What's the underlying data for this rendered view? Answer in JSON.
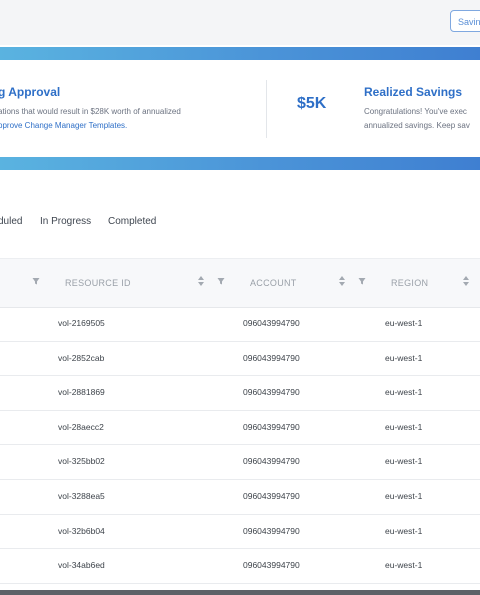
{
  "topbar": {
    "savings_button": "Savings"
  },
  "banner": {
    "left_title": "g Approval",
    "left_line1": "ations that would result in $28K worth of annualized",
    "left_line2": "pprove Change Manager Templates.",
    "big_value": "$5K",
    "right_title": "Realized Savings",
    "right_line1": "Congratulations! You've exec",
    "right_line2": "annualized savings. Keep sav"
  },
  "tabs": [
    "duled",
    "In Progress",
    "Completed"
  ],
  "table": {
    "headers": {
      "resource_id": "RESOURCE ID",
      "account": "ACCOUNT",
      "region": "REGION"
    },
    "rows": [
      {
        "resource_id": "vol-2169505",
        "account": "096043994790",
        "region": "eu-west-1"
      },
      {
        "resource_id": "vol-2852cab",
        "account": "096043994790",
        "region": "eu-west-1"
      },
      {
        "resource_id": "vol-2881869",
        "account": "096043994790",
        "region": "eu-west-1"
      },
      {
        "resource_id": "vol-28aecc2",
        "account": "096043994790",
        "region": "eu-west-1"
      },
      {
        "resource_id": "vol-325bb02",
        "account": "096043994790",
        "region": "eu-west-1"
      },
      {
        "resource_id": "vol-3288ea5",
        "account": "096043994790",
        "region": "eu-west-1"
      },
      {
        "resource_id": "vol-32b6b04",
        "account": "096043994790",
        "region": "eu-west-1"
      },
      {
        "resource_id": "vol-34ab6ed",
        "account": "096043994790",
        "region": "eu-west-1"
      }
    ]
  },
  "colors": {
    "accent": "#2e6fc7",
    "gradient_start": "#5ab3e0",
    "gradient_end": "#3f7fd1"
  }
}
